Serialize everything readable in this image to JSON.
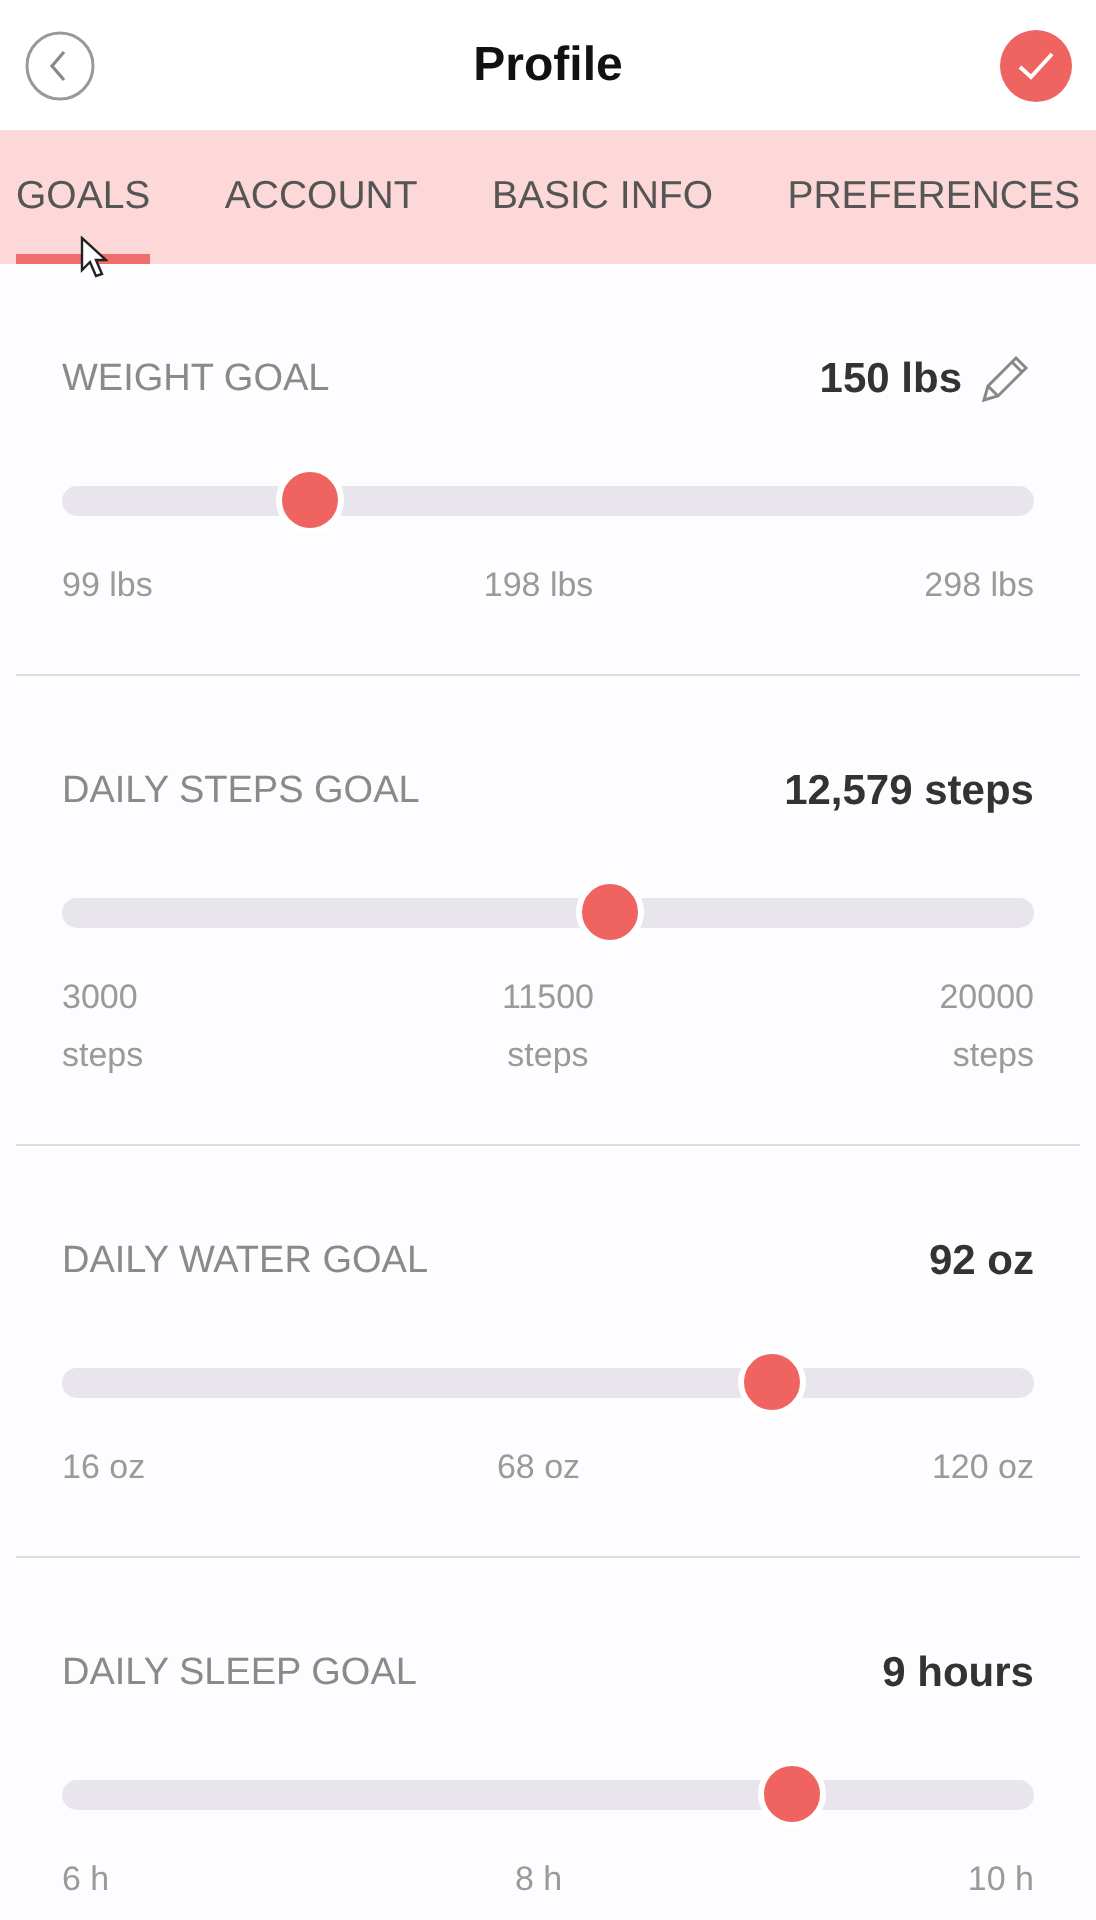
{
  "header": {
    "title": "Profile"
  },
  "tabs": [
    {
      "label": "GOALS",
      "selected": true
    },
    {
      "label": "ACCOUNT",
      "selected": false
    },
    {
      "label": "BASIC INFO",
      "selected": false
    },
    {
      "label": "PREFERENCES",
      "selected": false
    }
  ],
  "goals": [
    {
      "label": "WEIGHT GOAL",
      "value": "150 lbs",
      "editable": true,
      "level": 0.256,
      "ticks": [
        "99 lbs",
        "198 lbs",
        "298 lbs"
      ]
    },
    {
      "label": "DAILY STEPS GOAL",
      "value": "12,579 steps",
      "editable": false,
      "level": 0.563,
      "ticks": [
        "3000 steps",
        "11500 steps",
        "20000 steps"
      ]
    },
    {
      "label": "DAILY WATER GOAL",
      "value": "92 oz",
      "editable": false,
      "level": 0.73,
      "ticks": [
        "16 oz",
        "68 oz",
        "120 oz"
      ]
    },
    {
      "label": "DAILY SLEEP GOAL",
      "value": "9 hours",
      "editable": false,
      "level": 0.75,
      "ticks": [
        "6 h",
        "8 h",
        "10 h"
      ]
    }
  ]
}
